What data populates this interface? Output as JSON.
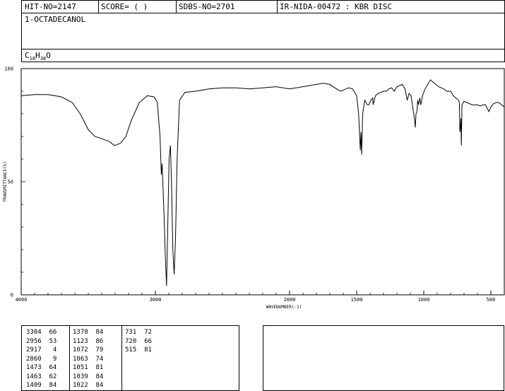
{
  "header": {
    "hit_no": "HIT-NO=2147",
    "score": "SCORE=  (   )",
    "sdbs_no": "SDBS-NO=2701",
    "ir_id": "IR-NIDA-00472 : KBR DISC"
  },
  "compound": {
    "name": "1-OCTADECANOL",
    "formula_c": "C",
    "formula_c_sub": "18",
    "formula_h": "H",
    "formula_h_sub": "38",
    "formula_o": "O"
  },
  "chart_data": {
    "type": "line",
    "xlabel": "WAVENUMBER(-1)",
    "ylabel": "TRANSMITTANCE(%)",
    "xlim": [
      4000,
      400
    ],
    "ylim": [
      0,
      100
    ],
    "x_ticks": [
      4000,
      3000,
      2000,
      1500,
      1000,
      500
    ],
    "y_ticks": [
      0,
      50,
      100
    ],
    "grid": false,
    "series": [
      {
        "x": [
          4000,
          3900,
          3800,
          3700,
          3620,
          3560,
          3500,
          3450,
          3400,
          3350,
          3304,
          3260,
          3220,
          3180,
          3120,
          3060,
          3010,
          2985,
          2965,
          2956,
          2950,
          2935,
          2925,
          2917,
          2908,
          2898,
          2888,
          2880,
          2870,
          2860,
          2850,
          2838,
          2820,
          2780,
          2700,
          2600,
          2500,
          2400,
          2300,
          2200,
          2100,
          2000,
          1900,
          1800,
          1750,
          1700,
          1650,
          1620,
          1600,
          1560,
          1530,
          1500,
          1485,
          1473,
          1468,
          1463,
          1455,
          1440,
          1420,
          1409,
          1395,
          1380,
          1378,
          1360,
          1340,
          1320,
          1300,
          1280,
          1260,
          1240,
          1220,
          1200,
          1180,
          1160,
          1140,
          1123,
          1110,
          1095,
          1085,
          1072,
          1068,
          1063,
          1058,
          1051,
          1045,
          1039,
          1030,
          1022,
          1010,
          990,
          970,
          950,
          930,
          910,
          890,
          870,
          850,
          830,
          800,
          780,
          760,
          740,
          735,
          731,
          727,
          723,
          720,
          715,
          700,
          680,
          660,
          640,
          620,
          600,
          580,
          560,
          540,
          515,
          500,
          480,
          460,
          440,
          420,
          400
        ],
        "y": [
          88,
          88.5,
          88.5,
          87.5,
          85,
          80,
          73,
          70,
          69,
          68,
          66,
          67,
          70,
          77,
          85,
          88,
          87.5,
          85,
          70,
          53,
          58,
          35,
          15,
          4,
          30,
          60,
          66,
          50,
          20,
          9,
          25,
          60,
          86,
          89.5,
          90,
          91,
          91.5,
          91.5,
          91,
          91.5,
          92,
          91,
          92,
          93,
          93.5,
          93,
          91,
          90,
          90.5,
          91.5,
          91,
          88,
          80,
          64,
          72,
          62,
          80,
          86,
          84,
          84,
          86,
          87,
          84,
          88,
          89,
          89.5,
          90,
          90,
          91,
          91.5,
          90,
          92,
          92.5,
          93,
          91,
          86,
          89,
          88,
          84,
          79,
          77,
          74,
          80,
          81,
          86,
          84,
          87,
          84,
          88,
          91,
          93,
          95,
          94,
          93,
          92,
          91.5,
          91,
          90,
          90,
          88,
          87,
          86,
          85,
          72,
          74,
          78,
          66,
          84,
          85.5,
          85,
          84.5,
          84,
          84,
          84,
          83.5,
          84,
          84,
          81,
          83,
          84.5,
          85,
          85,
          84,
          83
        ]
      }
    ],
    "peaks": [
      [
        3304,
        66
      ],
      [
        2956,
        53
      ],
      [
        2917,
        4
      ],
      [
        2860,
        9
      ],
      [
        1473,
        64
      ],
      [
        1463,
        62
      ],
      [
        1409,
        84
      ],
      [
        1378,
        84
      ],
      [
        1123,
        86
      ],
      [
        1072,
        79
      ],
      [
        1063,
        74
      ],
      [
        1051,
        81
      ],
      [
        1039,
        84
      ],
      [
        1022,
        84
      ],
      [
        731,
        72
      ],
      [
        720,
        66
      ],
      [
        515,
        81
      ]
    ]
  },
  "peak_table": {
    "col1": [
      "3304  66",
      "2956  53",
      "2917   4",
      "2860   9",
      "1473  64",
      "1463  62",
      "1409  84"
    ],
    "col2": [
      "1378  84",
      "1123  86",
      "1072  79",
      "1063  74",
      "1051  81",
      "1039  84",
      "1022  84"
    ],
    "col3": [
      "731  72",
      "720  66",
      "515  81"
    ]
  }
}
